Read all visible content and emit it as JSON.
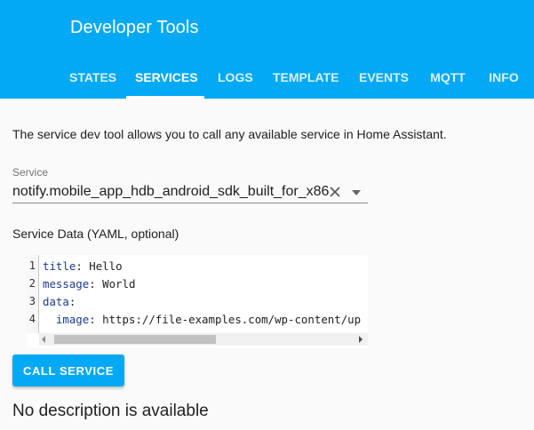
{
  "header": {
    "title": "Developer Tools",
    "tabs": [
      {
        "label": "STATES"
      },
      {
        "label": "SERVICES"
      },
      {
        "label": "LOGS"
      },
      {
        "label": "TEMPLATE"
      },
      {
        "label": "EVENTS"
      },
      {
        "label": "MQTT"
      },
      {
        "label": "INFO"
      }
    ],
    "active_tab": "SERVICES"
  },
  "main": {
    "intro": "The service dev tool allows you to call any available service in Home Assistant.",
    "service": {
      "label": "Service",
      "value": "notify.mobile_app_hdb_android_sdk_built_for_x86"
    },
    "yaml": {
      "label": "Service Data (YAML, optional)",
      "lines": [
        {
          "num": "1",
          "key": "title",
          "sep": ": ",
          "value": "Hello"
        },
        {
          "num": "2",
          "key": "message",
          "sep": ": ",
          "value": "World"
        },
        {
          "num": "3",
          "key": "data",
          "sep": ":",
          "value": ""
        },
        {
          "num": "4",
          "key": "  image",
          "sep": ": ",
          "value": "https://file-examples.com/wp-content/up"
        }
      ]
    },
    "call_button": "CALL SERVICE",
    "no_description": "No description is available"
  },
  "colors": {
    "accent": "#03a9f4",
    "yaml_key": "#1a3a91"
  },
  "icons": [
    "clear-icon",
    "dropdown-arrow-icon",
    "scroll-left-arrow-icon",
    "scroll-right-arrow-icon"
  ]
}
